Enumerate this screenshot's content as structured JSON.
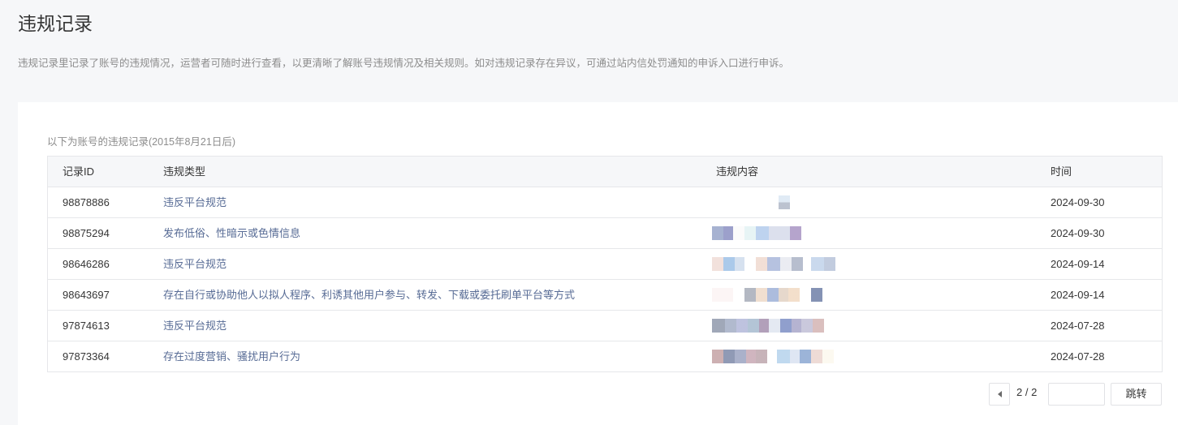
{
  "page": {
    "title": "违规记录",
    "description": "违规记录里记录了账号的违规情况，运营者可随时进行查看，以更清晰了解账号违规情况及相关规则。如对违规记录存在异议，可通过站内信处罚通知的申诉入口进行申诉。"
  },
  "records": {
    "subtitle": "以下为账号的违规记录(2015年8月21日后)",
    "columns": {
      "id": "记录ID",
      "type": "违规类型",
      "content": "违规内容",
      "time": "时间"
    },
    "rows": [
      {
        "id": "98878886",
        "type": "违反平台规范",
        "time": "2024-09-30"
      },
      {
        "id": "98875294",
        "type": "发布低俗、性暗示或色情信息",
        "time": "2024-09-30"
      },
      {
        "id": "98646286",
        "type": "违反平台规范",
        "time": "2024-09-14"
      },
      {
        "id": "98643697",
        "type": "存在自行或协助他人以拟人程序、利诱其他用户参与、转发、下载或委托刷单平台等方式",
        "time": "2024-09-14"
      },
      {
        "id": "97874613",
        "type": "违反平台规范",
        "time": "2024-07-28"
      },
      {
        "id": "97873364",
        "type": "存在过度营销、骚扰用户行为",
        "time": "2024-07-28"
      }
    ]
  },
  "pagination": {
    "prev_icon": "chevron-left-icon",
    "page_label": "2 / 2",
    "jump_input_value": "",
    "jump_label": "跳转"
  }
}
